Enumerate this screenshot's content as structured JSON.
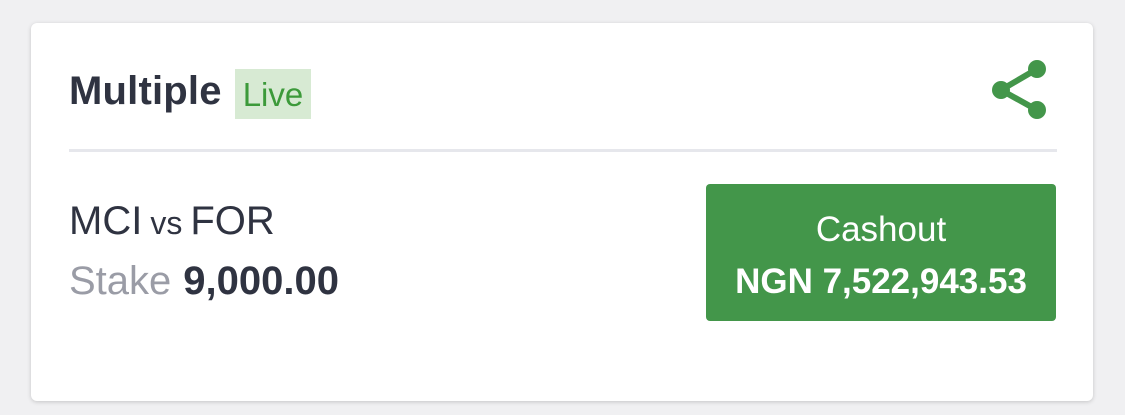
{
  "card": {
    "title": "Multiple",
    "badge": "Live",
    "share_icon": "share-icon",
    "match": {
      "home": "MCI",
      "vs": "vs",
      "away": "FOR"
    },
    "stake": {
      "label": "Stake",
      "value": "9,000.00"
    },
    "cashout": {
      "label": "Cashout",
      "amount": "NGN 7,522,943.53"
    }
  },
  "colors": {
    "accent_green": "#43964a",
    "badge_bg": "#d7ead3",
    "badge_text": "#3c9a3a",
    "text_dark": "#2f3341",
    "text_muted": "#9a9ca6"
  }
}
